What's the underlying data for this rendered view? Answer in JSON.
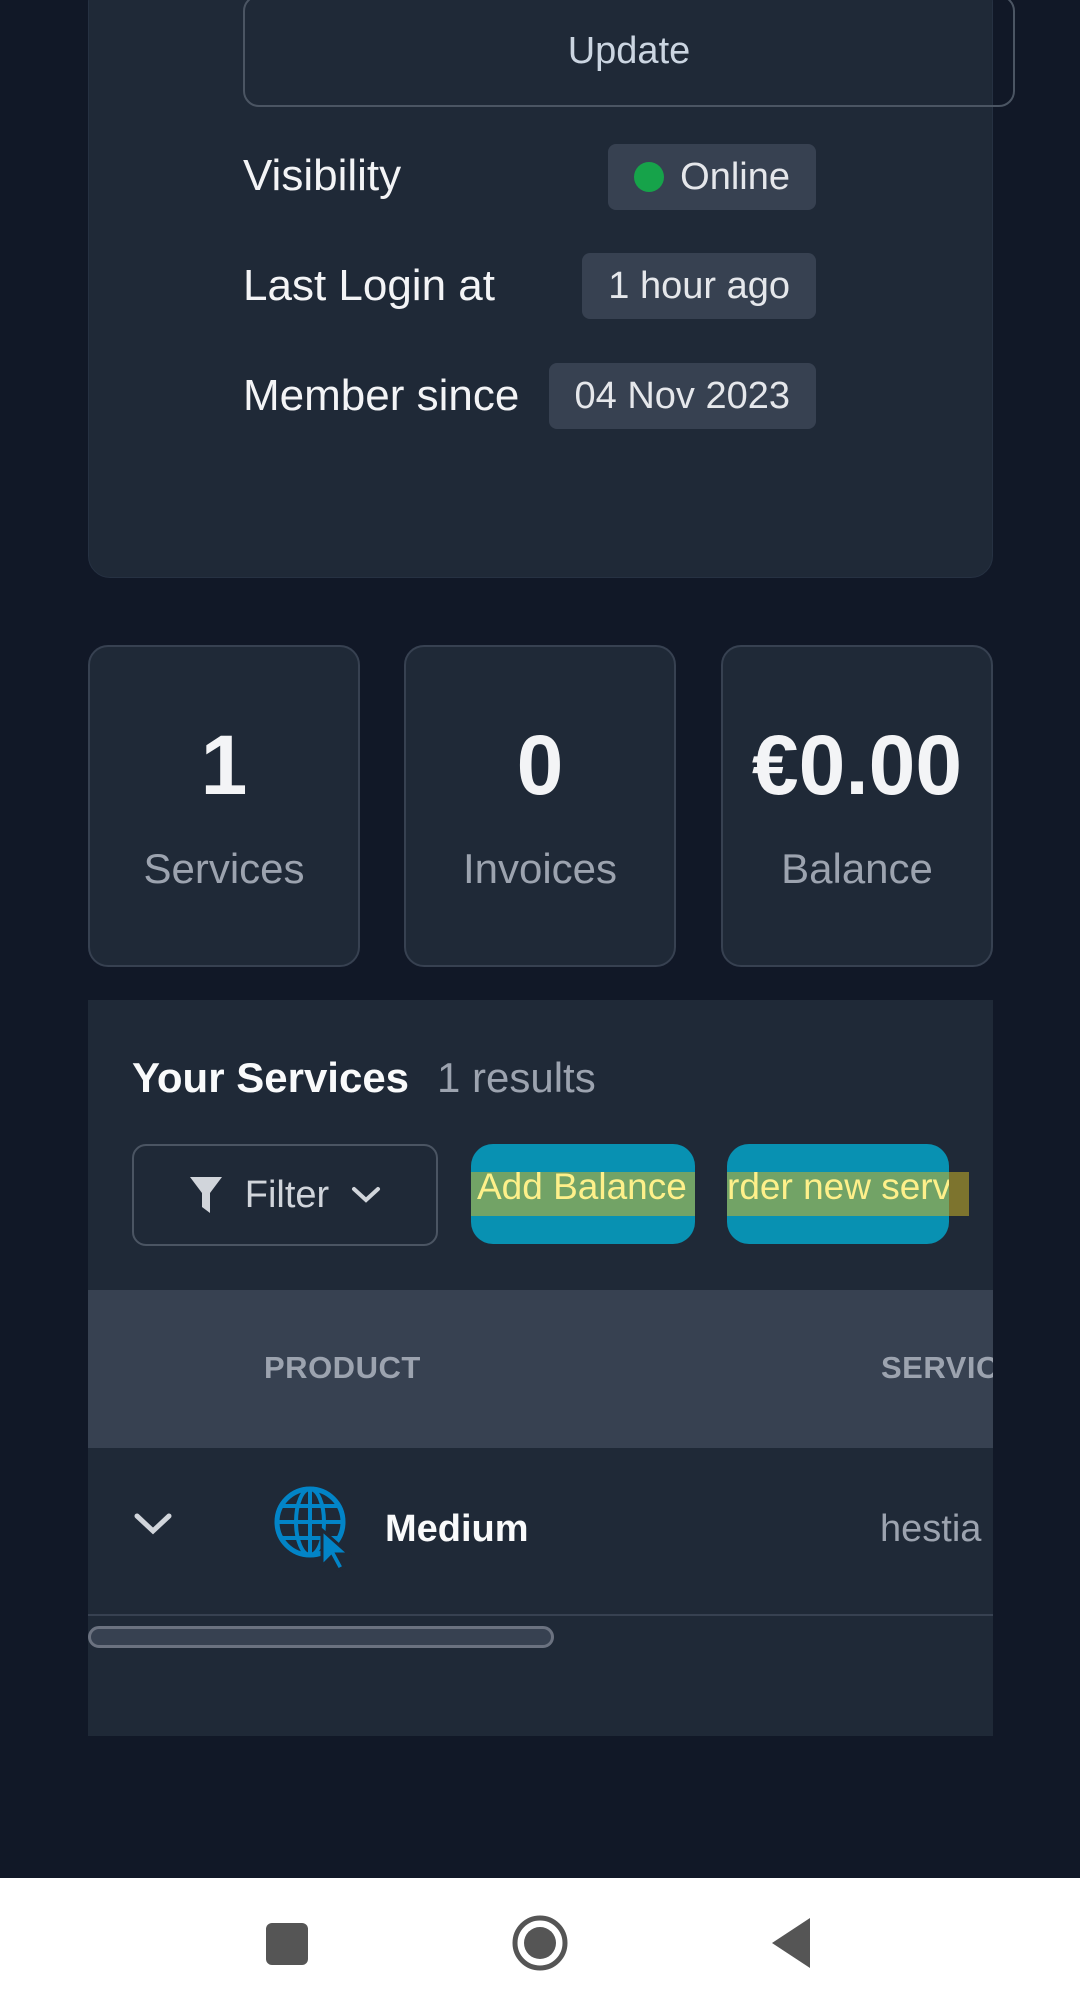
{
  "profile": {
    "update_label": "Update",
    "rows": [
      {
        "label": "Visibility",
        "value": "Online",
        "status_color": "#16a34a"
      },
      {
        "label": "Last Login at",
        "value": "1 hour ago"
      },
      {
        "label": "Member since",
        "value": "04 Nov 2023"
      }
    ]
  },
  "stats": [
    {
      "value": "1",
      "label": "Services"
    },
    {
      "value": "0",
      "label": "Invoices"
    },
    {
      "value": "€0.00",
      "label": "Balance"
    }
  ],
  "services": {
    "title": "Your Services",
    "count": "1 results",
    "filter_label": "Filter",
    "add_balance_label": "Add Balance",
    "order_label": "rder new serv",
    "columns": [
      "PRODUCT",
      "SERVIC"
    ],
    "rows": [
      {
        "product": "Medium",
        "service": "hestia",
        "icon": "globe-cursor-icon"
      }
    ]
  },
  "colors": {
    "background": "#111827",
    "card": "#1f2937",
    "accent": "#0891b2",
    "icon_blue": "#0284c7"
  },
  "nav": {
    "icons": [
      "recents-square-icon",
      "home-circle-icon",
      "back-triangle-icon"
    ]
  }
}
